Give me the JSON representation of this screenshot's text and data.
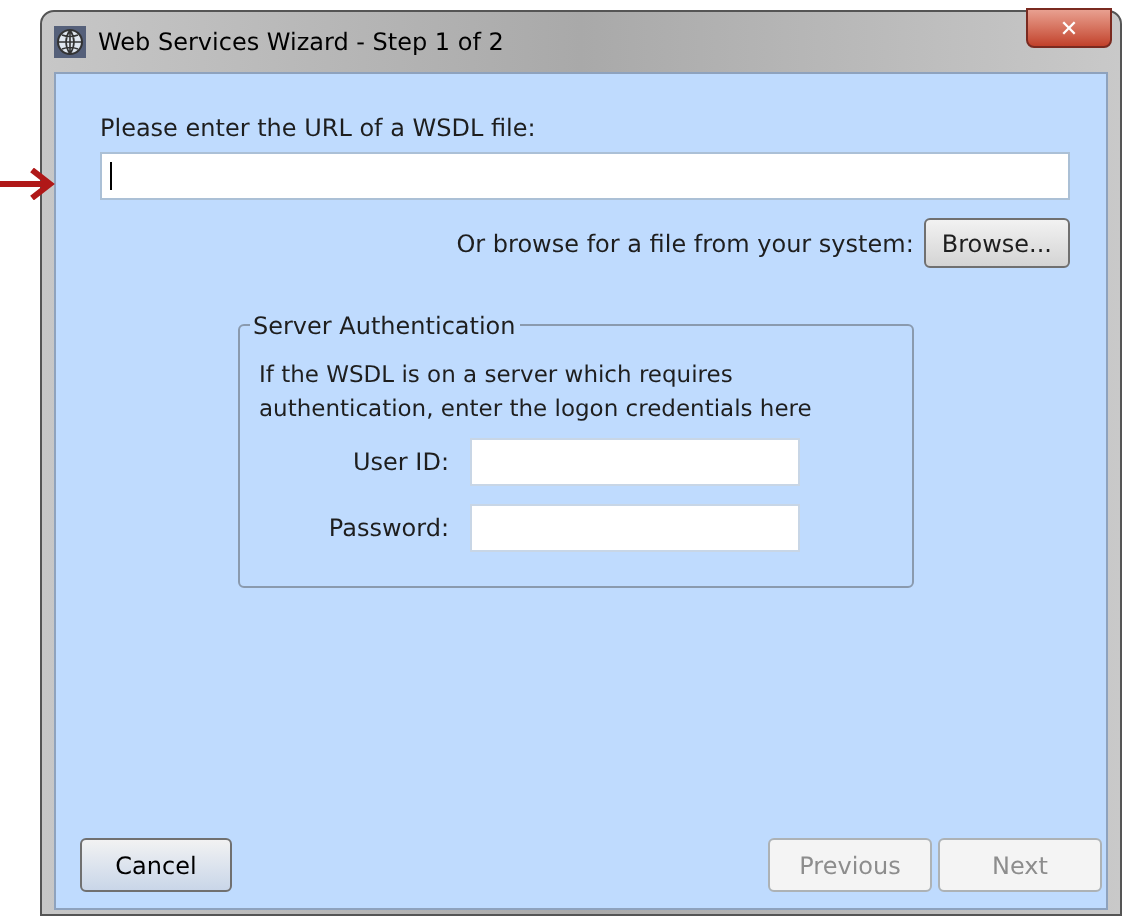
{
  "window": {
    "title": "Web Services Wizard - Step 1 of 2",
    "close": "✕"
  },
  "url_prompt": "Please enter the URL of a WSDL file:",
  "url_field": {
    "focused": true
  },
  "browse": {
    "label": "Or browse for a file from your system:",
    "button": "Browse..."
  },
  "auth_group": {
    "title": "Server Authentication",
    "description": "If the WSDL is on a server which requires authentication, enter the logon credentials here",
    "fields": [
      {
        "label": "User ID:"
      },
      {
        "label": "Password:"
      }
    ]
  },
  "buttons": [
    {
      "label": "Cancel",
      "disabled": false,
      "kind": "cancel"
    },
    {
      "label": "Previous",
      "disabled": true,
      "kind": "nav"
    },
    {
      "label": "Next",
      "disabled": true,
      "kind": "nav"
    }
  ]
}
